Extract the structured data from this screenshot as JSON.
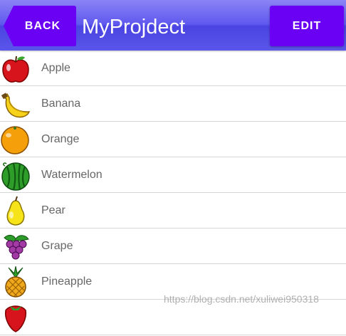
{
  "header": {
    "back_label": "BACK",
    "title": "MyProjdect",
    "edit_label": "EDIT"
  },
  "fruits": [
    {
      "name": "Apple",
      "icon": "apple-icon"
    },
    {
      "name": "Banana",
      "icon": "banana-icon"
    },
    {
      "name": "Orange",
      "icon": "orange-icon"
    },
    {
      "name": "Watermelon",
      "icon": "watermelon-icon"
    },
    {
      "name": "Pear",
      "icon": "pear-icon"
    },
    {
      "name": "Grape",
      "icon": "grape-icon"
    },
    {
      "name": "Pineapple",
      "icon": "pineapple-icon"
    },
    {
      "name": "",
      "icon": "strawberry-icon"
    }
  ],
  "watermark": "https://blog.csdn.net/xuliwei950318",
  "colors": {
    "titlebar": "#5f58ee",
    "button": "#6a00f4",
    "label": "#666666",
    "divider": "#d6d6d6"
  }
}
